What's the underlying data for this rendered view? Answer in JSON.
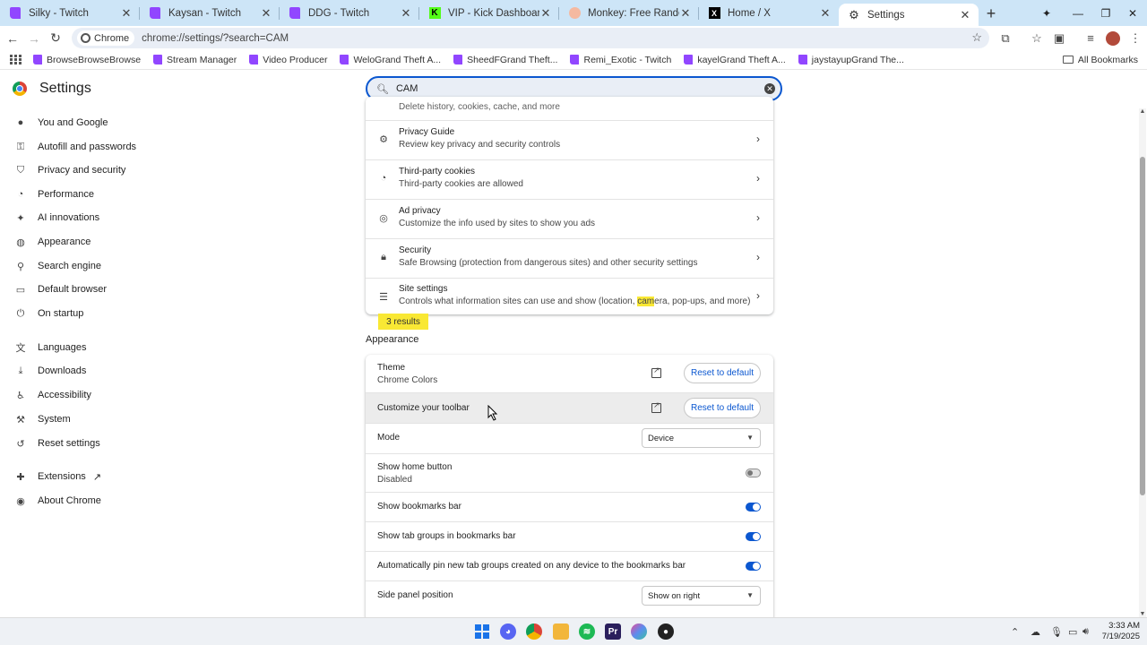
{
  "tabs": [
    {
      "title": "Silky - Twitch",
      "icon": "twitch"
    },
    {
      "title": "Kaysan - Twitch",
      "icon": "twitch"
    },
    {
      "title": "DDG - Twitch",
      "icon": "twitch"
    },
    {
      "title": "VIP - Kick Dashboard",
      "icon": "kick"
    },
    {
      "title": "Monkey: Free Random Video Chat",
      "icon": "monkey"
    },
    {
      "title": "Home / X",
      "icon": "x"
    },
    {
      "title": "Settings",
      "icon": "gear",
      "active": true
    }
  ],
  "toolbar": {
    "chip_label": "Chrome",
    "url": "chrome://settings/?search=CAM"
  },
  "bookmarks": [
    "BrowseBrowseBrowse",
    "Stream Manager",
    "Video Producer",
    "WeloGrand Theft A...",
    "SheedFGrand Theft...",
    "Remi_Exotic - Twitch",
    "kayelGrand Theft A...",
    "jaystayupGrand The..."
  ],
  "all_bookmarks": "All Bookmarks",
  "settings": {
    "title": "Settings",
    "search_value": "CAM"
  },
  "sidebar": {
    "items": [
      {
        "label": "You and Google",
        "icon": "person-icon"
      },
      {
        "label": "Autofill and passwords",
        "icon": "key-icon"
      },
      {
        "label": "Privacy and security",
        "icon": "shield-icon"
      },
      {
        "label": "Performance",
        "icon": "speedometer-icon"
      },
      {
        "label": "AI innovations",
        "icon": "sparkle-icon"
      },
      {
        "label": "Appearance",
        "icon": "palette-icon"
      },
      {
        "label": "Search engine",
        "icon": "search-icon"
      },
      {
        "label": "Default browser",
        "icon": "browser-icon"
      },
      {
        "label": "On startup",
        "icon": "power-icon"
      },
      {
        "label": "Languages",
        "icon": "translate-icon"
      },
      {
        "label": "Downloads",
        "icon": "download-icon"
      },
      {
        "label": "Accessibility",
        "icon": "accessibility-icon"
      },
      {
        "label": "System",
        "icon": "wrench-icon"
      },
      {
        "label": "Reset settings",
        "icon": "reset-icon"
      },
      {
        "label": "Extensions",
        "icon": "puzzle-icon"
      },
      {
        "label": "About Chrome",
        "icon": "chrome-icon"
      }
    ]
  },
  "privacy": {
    "partial_row_text": "Delete history, cookies, cache, and more",
    "rows": [
      {
        "title": "Privacy Guide",
        "subtitle": "Review key privacy and security controls",
        "icon": "privacy-guide-icon"
      },
      {
        "title": "Third-party cookies",
        "subtitle": "Third-party cookies are allowed",
        "icon": "cookie-icon"
      },
      {
        "title": "Ad privacy",
        "subtitle": "Customize the info used by sites to show you ads",
        "icon": "ad-privacy-icon"
      },
      {
        "title": "Security",
        "subtitle": "Safe Browsing (protection from dangerous sites) and other security settings",
        "icon": "lock-icon"
      },
      {
        "title": "Site settings",
        "subtitle_before": "Controls what information sites can use and show (location, ",
        "subtitle_match": "cam",
        "subtitle_after": "era, pop-ups, and more)",
        "icon": "sliders-icon"
      }
    ],
    "results_badge": "3 results"
  },
  "appearance": {
    "section_title": "Appearance",
    "theme_label": "Theme",
    "theme_value": "Chrome Colors",
    "theme_reset": "Reset to default",
    "toolbar_label": "Customize your toolbar",
    "toolbar_reset": "Reset to default",
    "mode_label": "Mode",
    "mode_value": "Device",
    "home_label": "Show home button",
    "home_value": "Disabled",
    "home_on": false,
    "bookmarks_label": "Show bookmarks bar",
    "bookmarks_on": true,
    "tabgroups_label": "Show tab groups in bookmarks bar",
    "tabgroups_on": true,
    "autopin_label": "Automatically pin new tab groups created on any device to the bookmarks bar",
    "autopin_on": true,
    "sidepanel_label": "Side panel position",
    "sidepanel_value": "Show on right"
  },
  "taskbar": {
    "time": "3:33 AM",
    "date": "7/19/2025"
  },
  "colors": {
    "accent": "#0b57d0",
    "tabstrip": "#cde5f7",
    "highlight": "#f9e834"
  }
}
